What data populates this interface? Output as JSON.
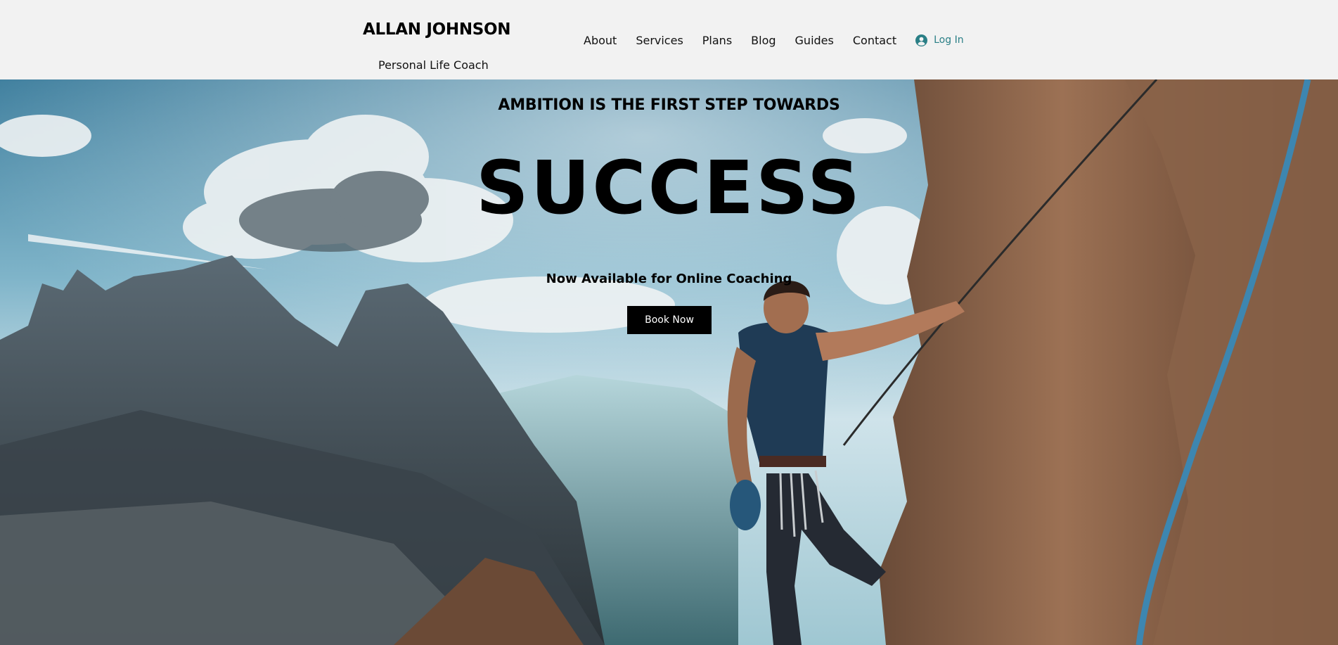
{
  "header": {
    "brand_name": "ALLAN JOHNSON",
    "brand_tagline": "Personal Life Coach",
    "nav": [
      {
        "label": "About"
      },
      {
        "label": "Services"
      },
      {
        "label": "Plans"
      },
      {
        "label": "Blog"
      },
      {
        "label": "Guides"
      },
      {
        "label": "Contact"
      }
    ],
    "login_label": "Log In",
    "login_icon": "user-circle-icon"
  },
  "hero": {
    "kicker": "AMBITION IS THE FIRST STEP TOWARDS",
    "title": "SUCCESS",
    "subtitle": "Now Available for Online Coaching",
    "cta_label": "Book Now",
    "image": "rock-climber-mountain-valley"
  },
  "colors": {
    "header_bg": "#f2f2f2",
    "accent": "#2a7f86",
    "button_bg": "#000000",
    "button_text": "#ffffff"
  }
}
